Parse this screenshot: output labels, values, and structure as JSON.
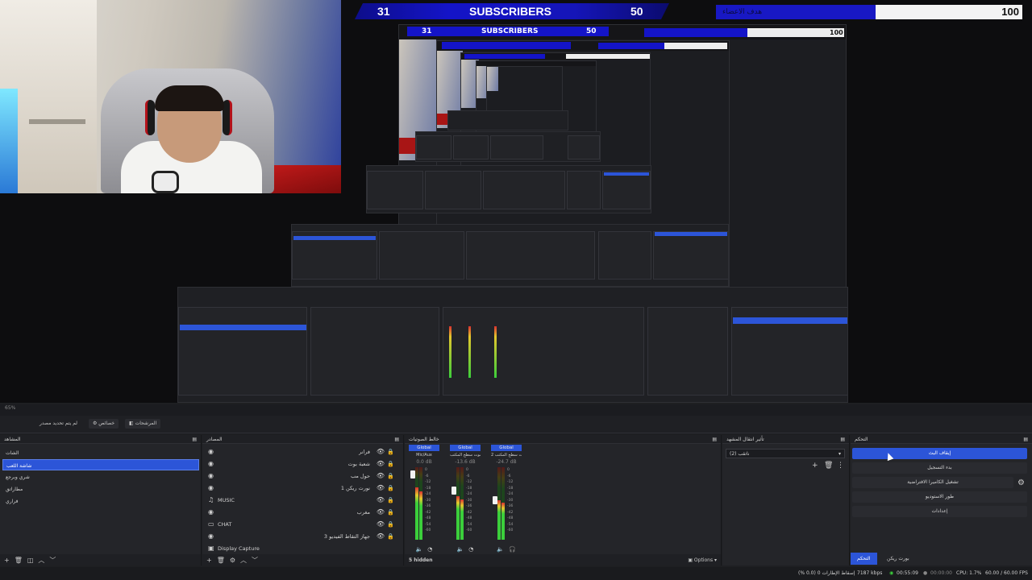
{
  "overlay": {
    "sub_count": "31",
    "sub_title": "SUBSCRIBERS",
    "sub_goal": "50",
    "goal_label": "هدف الاعضاء",
    "goal_max": "100",
    "goal_fraction": 0.52,
    "accent": "#1414c8"
  },
  "nested": {
    "sub_count": "31",
    "sub_title": "SUBSCRIBERS",
    "sub_goal": "50",
    "goal_max": "100"
  },
  "toolbar": {
    "zoom": "65%",
    "tab1": "لم يتم تحديد مصدر",
    "tab2": "خصائص",
    "tab3": "المرشحات"
  },
  "scenes": {
    "title": "المشاهد",
    "items": [
      "الشات",
      "شاشة اللعب",
      "شري وبرجع",
      "مطاراتق",
      "فراري"
    ],
    "active_index": 1
  },
  "sources": {
    "title": "المصادر",
    "items": [
      {
        "label": "فرانر",
        "ltr": false
      },
      {
        "label": "شعبة بوت",
        "ltr": false
      },
      {
        "label": "حول مب",
        "ltr": false
      },
      {
        "label": "نورت ريكن 1",
        "ltr": false
      },
      {
        "label": "MUSIC",
        "ltr": true
      },
      {
        "label": "مغرب",
        "ltr": false
      },
      {
        "label": "CHAT",
        "ltr": true
      },
      {
        "label": "جهاز التقاط الفيديو 3",
        "ltr": false
      },
      {
        "label": "Display Capture",
        "ltr": true
      }
    ]
  },
  "mixer": {
    "title": "خالط الصوتيات",
    "channels": [
      {
        "head": "Global",
        "name": "Mic/Aux",
        "db": "0.0 dB",
        "level": 0.72,
        "fader": 0.95
      },
      {
        "head": "Global",
        "name": "صوت سطح المكتب",
        "db": "-13.6 dB",
        "level": 0.6,
        "fader": 0.7
      },
      {
        "head": "Global",
        "name": "صوت سطح المكتب 2",
        "db": "-24.7 dB",
        "level": 0.55,
        "fader": 0.55
      }
    ],
    "scale": [
      "0",
      "-6",
      "-12",
      "-18",
      "-24",
      "-30",
      "-36",
      "-42",
      "-48",
      "-54",
      "-60"
    ],
    "hidden_label": "5 hidden",
    "options_label": "Options"
  },
  "transitions": {
    "title": "تأثير انتقال المشهد",
    "selected": "(2) ناتقب"
  },
  "controls": {
    "title": "التحكم",
    "buttons": [
      "إيقاف البث",
      "بدء التسجيل",
      "تشغيل الكاميرا الافتراضية",
      "طور الاستوديو",
      "إعدادات"
    ],
    "tab_active": "التحكم",
    "tab_other": "بورت ريكن"
  },
  "status": {
    "dropped": "إسقاط الإطارات 0 (0.0 %)",
    "bitrate": "7187 kbps",
    "live_time": "00:55:09",
    "rec_time": "00:00:00",
    "cpu": "CPU: 1.7%",
    "fps": "60.00 / 60.00 FPS"
  }
}
